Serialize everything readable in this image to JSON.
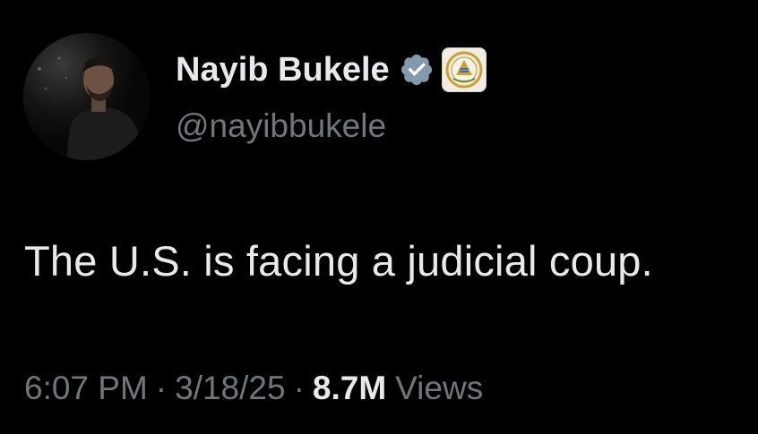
{
  "author": {
    "display_name": "Nayib Bukele",
    "handle": "@nayibbukele",
    "verified_icon": "verified-badge-icon",
    "affiliate_icon": "el-salvador-coat-of-arms-icon",
    "avatar_icon": "profile-photo"
  },
  "tweet": {
    "text": "The U.S. is facing a judicial coup."
  },
  "meta": {
    "time": "6:07 PM",
    "separator": "·",
    "date": "3/18/25",
    "views_count": "8.7M",
    "views_label": "Views"
  },
  "colors": {
    "background": "#000000",
    "primary_text": "#e7e9ea",
    "secondary_text": "#71767b",
    "verified": "#829aab"
  }
}
